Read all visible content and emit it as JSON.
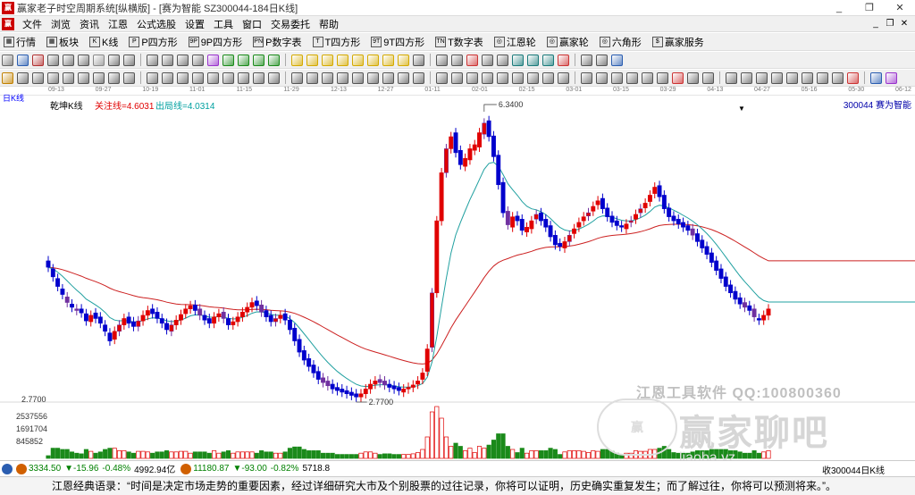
{
  "window": {
    "title": "赢家老子时空周期系统[纵横版] - [赛为智能  SZ300044-184日K线]",
    "app_icon": "app-logo-icon",
    "controls": [
      "_",
      "❐",
      "✕"
    ]
  },
  "menubar": {
    "logo": "赢",
    "items": [
      "文件",
      "浏览",
      "资讯",
      "江恩",
      "公式选股",
      "设置",
      "工具",
      "窗口",
      "交易委托",
      "帮助"
    ],
    "right": [
      "_",
      "❐",
      "✕"
    ]
  },
  "toolbar1": {
    "items": [
      {
        "icon": "grid-icon",
        "glyph": "▦",
        "label": "行情"
      },
      {
        "icon": "block-icon",
        "glyph": "▦",
        "label": "板块"
      },
      {
        "icon": "kline-icon",
        "glyph": "K",
        "label": "K线"
      },
      {
        "icon": "p-square-icon",
        "glyph": "P",
        "label": "P四方形"
      },
      {
        "icon": "9p-square-icon",
        "glyph": "9P",
        "label": "9P四方形"
      },
      {
        "icon": "p-digit-icon",
        "glyph": "PN",
        "label": "P数字表"
      },
      {
        "icon": "t-square-icon",
        "glyph": "T",
        "label": "T四方形"
      },
      {
        "icon": "9t-square-icon",
        "glyph": "9T",
        "label": "9T四方形"
      },
      {
        "icon": "t-digit-icon",
        "glyph": "TN",
        "label": "T数字表"
      },
      {
        "icon": "gann-wheel-icon",
        "glyph": "◎",
        "label": "江恩轮"
      },
      {
        "icon": "winner-wheel-icon",
        "glyph": "◎",
        "label": "赢家轮"
      },
      {
        "icon": "hexagon-icon",
        "glyph": "◎",
        "label": "六角形"
      },
      {
        "icon": "service-icon",
        "glyph": "$",
        "label": "赢家服务"
      }
    ]
  },
  "toolbar2": {
    "icons": [
      "#666",
      "#2a5db0",
      "#b03030",
      "#555",
      "#555",
      "#555",
      "#888",
      "#555",
      "#555",
      "#555",
      "#555",
      "#555",
      "#555",
      "#9933cc",
      "#1a8a1a",
      "#1a8a1a",
      "#1a8a1a",
      "#1a8a1a",
      "#d4aa00",
      "#d4aa00",
      "#d4aa00",
      "#d4aa00",
      "#d4aa00",
      "#d4aa00",
      "#d4aa00",
      "#d4aa00",
      "#555",
      "#555",
      "#555",
      "#cc3333",
      "#555",
      "#555",
      "#1a7a7a",
      "#1a7a7a",
      "#1a7a7a",
      "#cc3333",
      "#555",
      "#555",
      "#2a5db0"
    ]
  },
  "toolbar3": {
    "icons": [
      "#c08000",
      "#555",
      "#555",
      "#555",
      "#555",
      "#555",
      "#555",
      "#555",
      "#555",
      "#555",
      "#555",
      "#555",
      "#555",
      "#555",
      "#555",
      "#555",
      "#555",
      "#555",
      "#555",
      "#555",
      "#555",
      "#555",
      "#555",
      "#555",
      "#555",
      "#555",
      "#555",
      "#555",
      "#555",
      "#555",
      "#555",
      "#555",
      "#555",
      "#555",
      "#555",
      "#555",
      "#555",
      "#555",
      "#555",
      "#555",
      "#555",
      "#555",
      "#cc3333",
      "#555",
      "#555",
      "#555",
      "#555",
      "#555",
      "#555",
      "#555",
      "#555",
      "#555",
      "#555",
      "#cc3333",
      "#2a5db0",
      "#9933cc"
    ]
  },
  "datebar": {
    "dates": [
      "09-13",
      "09-27",
      "10-19",
      "11-01",
      "11-15",
      "11-29",
      "12-13",
      "12-27",
      "01-11",
      "02-01",
      "02-15",
      "03-01",
      "03-15",
      "03-29",
      "04-13",
      "04-27",
      "05-16",
      "05-30",
      "06-12"
    ]
  },
  "chart": {
    "period_label": "日K线",
    "indicator_name": "乾坤K线",
    "follow_line_label": "关注线=4.6031",
    "exit_line_label": "出局线=4.0314",
    "stock": "300044  赛为智能",
    "high_label": "6.3400",
    "low_label": "2.7700",
    "left_axis_price": "2.7700",
    "volume_ticks": [
      "2537556",
      "1691704",
      "845852"
    ],
    "watermark_title": "江恩工具软件  QQ:100800360",
    "watermark_logo": "赢",
    "watermark_big": "赢家聊吧",
    "watermark_url": "liaoba.yz"
  },
  "chart_data": {
    "type": "candlestick",
    "symbol": "300044",
    "name": "赛为智能",
    "high": 6.34,
    "low": 2.77,
    "follow_line": 4.6031,
    "exit_line": 4.0314,
    "volume_ticks": [
      2537556,
      1691704,
      845852
    ],
    "x_ticks": [
      "09-13",
      "09-27",
      "10-19",
      "11-01",
      "11-15",
      "11-29",
      "12-13",
      "12-27",
      "01-11",
      "02-01",
      "02-15",
      "03-01",
      "03-15",
      "03-29",
      "04-13",
      "04-27",
      "05-16",
      "05-30",
      "06-12"
    ],
    "close": [
      4.42,
      4.3,
      4.18,
      4.08,
      3.98,
      3.92,
      3.88,
      3.85,
      3.75,
      3.82,
      3.78,
      3.72,
      3.62,
      3.5,
      3.62,
      3.7,
      3.78,
      3.72,
      3.68,
      3.75,
      3.82,
      3.88,
      3.84,
      3.78,
      3.72,
      3.64,
      3.7,
      3.76,
      3.83,
      3.9,
      3.94,
      3.88,
      3.82,
      3.76,
      3.72,
      3.8,
      3.84,
      3.78,
      3.7,
      3.74,
      3.8,
      3.86,
      3.92,
      3.98,
      3.94,
      3.86,
      3.8,
      3.74,
      3.78,
      3.82,
      3.76,
      3.64,
      3.5,
      3.36,
      3.26,
      3.18,
      3.1,
      3.02,
      2.98,
      2.94,
      2.9,
      2.88,
      2.86,
      2.84,
      2.82,
      2.8,
      2.84,
      2.9,
      2.96,
      3.0,
      2.98,
      2.95,
      2.92,
      2.9,
      2.88,
      2.9,
      2.92,
      2.95,
      3.0,
      3.1,
      3.4,
      4.1,
      5.0,
      5.6,
      5.9,
      6.05,
      5.85,
      5.7,
      5.78,
      5.9,
      5.95,
      6.1,
      6.22,
      6.05,
      5.8,
      5.45,
      5.1,
      4.95,
      5.05,
      5.0,
      4.88,
      4.92,
      5.0,
      5.08,
      5.0,
      4.92,
      4.8,
      4.7,
      4.68,
      4.74,
      4.82,
      4.9,
      4.98,
      5.05,
      5.1,
      5.18,
      5.25,
      5.15,
      5.05,
      4.98,
      4.94,
      4.92,
      4.96,
      5.0,
      5.08,
      5.15,
      5.22,
      5.32,
      5.42,
      5.3,
      5.15,
      5.05,
      5.0,
      4.96,
      4.92,
      4.88,
      4.82,
      4.74,
      4.66,
      4.58,
      4.48,
      4.38,
      4.28,
      4.18,
      4.1,
      4.02,
      3.96,
      3.92,
      3.88,
      3.8,
      3.76,
      3.82,
      3.9
    ],
    "open": [
      4.5,
      4.4,
      4.28,
      4.15,
      4.05,
      3.96,
      3.9,
      3.9,
      3.84,
      3.74,
      3.85,
      3.8,
      3.7,
      3.6,
      3.52,
      3.62,
      3.7,
      3.8,
      3.74,
      3.68,
      3.75,
      3.82,
      3.9,
      3.86,
      3.78,
      3.72,
      3.62,
      3.7,
      3.76,
      3.84,
      3.9,
      3.95,
      3.9,
      3.82,
      3.78,
      3.72,
      3.8,
      3.86,
      3.78,
      3.7,
      3.74,
      3.8,
      3.86,
      3.92,
      4.0,
      3.95,
      3.88,
      3.82,
      3.74,
      3.78,
      3.84,
      3.76,
      3.66,
      3.52,
      3.38,
      3.28,
      3.2,
      3.12,
      3.04,
      3.0,
      2.96,
      2.92,
      2.9,
      2.88,
      2.86,
      2.84,
      2.8,
      2.84,
      2.9,
      2.96,
      3.02,
      3.0,
      2.96,
      2.94,
      2.92,
      2.86,
      2.9,
      2.92,
      2.96,
      3.02,
      3.12,
      3.42,
      4.1,
      5.0,
      5.6,
      5.9,
      6.1,
      5.88,
      5.68,
      5.76,
      5.88,
      5.92,
      6.08,
      6.25,
      6.06,
      5.82,
      5.48,
      5.12,
      4.92,
      5.06,
      5.02,
      4.86,
      4.9,
      5.02,
      5.1,
      5.02,
      4.94,
      4.82,
      4.72,
      4.66,
      4.74,
      4.84,
      4.92,
      5.0,
      5.06,
      5.12,
      5.2,
      5.28,
      5.16,
      5.06,
      5.0,
      4.94,
      4.9,
      4.98,
      5.02,
      5.1,
      5.16,
      5.24,
      5.34,
      5.44,
      5.32,
      5.16,
      5.06,
      5.02,
      4.98,
      4.94,
      4.9,
      4.84,
      4.76,
      4.68,
      4.6,
      4.5,
      4.4,
      4.3,
      4.2,
      4.12,
      4.04,
      3.98,
      3.94,
      3.9,
      3.78,
      3.76,
      3.82
    ]
  },
  "statusbar": {
    "sh_index": "3334.50",
    "sh_change": "▼-15.96",
    "sh_pct": "-0.48%",
    "sh_amount": "4992.94亿",
    "sz_index": "11180.87",
    "sz_change": "▼-93.00",
    "sz_pct": "-0.82%",
    "sz_amount": "5718.8",
    "right_text": "收300044日K线"
  },
  "quote": {
    "text": "江恩经典语录：“时间是决定市场走势的重要因素，经过详细研究大市及个别股票的过往记录，你将可以证明，历史确实重复发生；而了解过往，你将可以预测将来。”。"
  }
}
